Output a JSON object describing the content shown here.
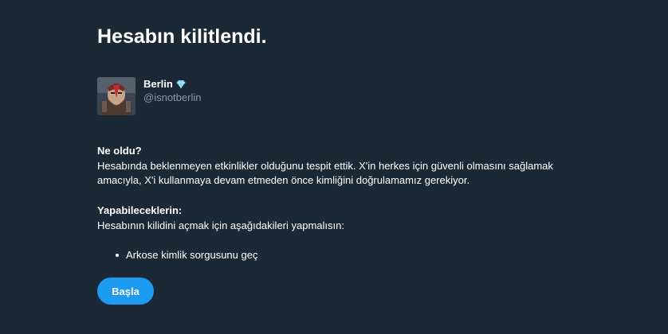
{
  "page": {
    "title": "Hesabın kilitlendi."
  },
  "profile": {
    "name": "Berlin",
    "handle": "@isnotberlin",
    "avatar_icon": "user-avatar-image",
    "badge_icon": "diamond-icon",
    "badge_color": "#7dd3f0"
  },
  "what_happened": {
    "heading": "Ne oldu?",
    "body": "Hesabında beklenmeyen etkinlikler olduğunu tespit ettik. X'in herkes için güvenli olmasını sağlamak amacıyla, X'i kullanmaya devam etmeden önce kimliğini doğrulamamız gerekiyor."
  },
  "what_to_do": {
    "heading": "Yapabileceklerin:",
    "body": "Hesabının kilidini açmak için aşağıdakileri yapmalısın:",
    "steps": [
      "Arkose kimlik sorgusunu geç"
    ]
  },
  "actions": {
    "start_label": "Başla"
  },
  "colors": {
    "background": "#1b2836",
    "accent": "#1d9bf0",
    "muted_text": "#8b98a5"
  }
}
